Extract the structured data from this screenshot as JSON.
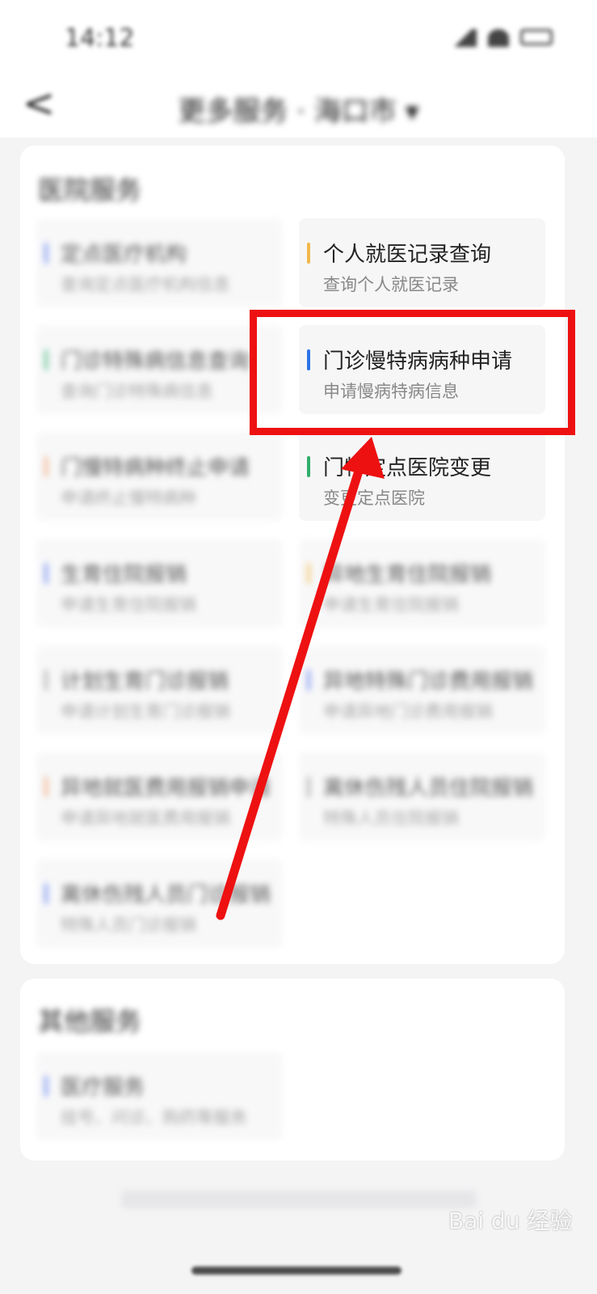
{
  "status_bar": {
    "time": "14:12"
  },
  "nav": {
    "back": "<",
    "title": "更多服务 · 海口市 ▾"
  },
  "hospital_section": {
    "title": "医院服务"
  },
  "other_section": {
    "title": "其他服务"
  },
  "services": [
    {
      "title": "定点医疗机构",
      "sub": "查询定点医疗机构信息",
      "color": "#5b7cf0"
    },
    {
      "title": "个人就医记录查询",
      "sub": "查询个人就医记录",
      "color": "#f2b84b"
    },
    {
      "title": "门诊特殊病信息查询",
      "sub": "查询门诊特殊病信息",
      "color": "#3bb47a"
    },
    {
      "title": "门诊慢特病病种申请",
      "sub": "申请慢病特病信息",
      "color": "#2d73e8"
    },
    {
      "title": "门慢特病种终止申请",
      "sub": "申请终止慢特病种",
      "color": "#f0a070"
    },
    {
      "title": "门特定点医院变更",
      "sub": "变更定点医院",
      "color": "#2fae6b"
    },
    {
      "title": "生育住院报销",
      "sub": "申请生育住院报销",
      "color": "#5b7cf0"
    },
    {
      "title": "异地生育住院报销",
      "sub": "申请生育住院报销",
      "color": "#f2b84b"
    },
    {
      "title": "计划生育门诊报销",
      "sub": "申请计划生育门诊报销",
      "color": "#9a9a9a"
    },
    {
      "title": "异地特殊门诊费用报销",
      "sub": "申请异地门诊费用报销",
      "color": "#5b7cf0"
    },
    {
      "title": "异地就医费用报销申请",
      "sub": "申请异地就医费用报销",
      "color": "#f0a070"
    },
    {
      "title": "离休伤残人员住院报销",
      "sub": "特殊人员住院报销",
      "color": "#9a9a9a"
    },
    {
      "title": "离休伤残人员门诊报销",
      "sub": "特殊人员门诊报销",
      "color": "#5b7cf0"
    }
  ],
  "other_services": [
    {
      "title": "医疗服务",
      "sub": "挂号、问诊、购药等服务",
      "color": "#5b7cf0"
    }
  ],
  "watermark": "Bai du 经验"
}
